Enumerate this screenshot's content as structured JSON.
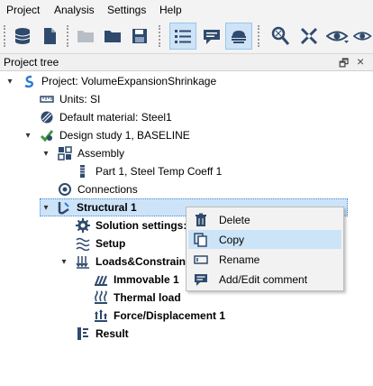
{
  "menu": [
    "Project",
    "Analysis",
    "Settings",
    "Help"
  ],
  "toolbar": {
    "buttons": [
      "database-icon",
      "new-document-icon",
      "open-folder-disabled-icon",
      "open-folder-icon",
      "save-icon",
      "list-view-icon",
      "comment-icon",
      "cloud-icon",
      "mesh-icon",
      "tools-icon",
      "eye-icon",
      "eye-icon"
    ]
  },
  "panel": {
    "title": "Project tree",
    "float_btn": "🗗",
    "close_btn": "×"
  },
  "tree": [
    {
      "label": "Project: VolumeExpansionShrinkage",
      "icon": "project-icon",
      "arrow": "▾",
      "bold": false
    },
    {
      "label": "Units: SI",
      "icon": "ruler-icon",
      "arrow": "",
      "bold": false
    },
    {
      "label": "Default material: Steel1",
      "icon": "material-icon",
      "arrow": "",
      "bold": false
    },
    {
      "label": "Design study 1, BASELINE",
      "icon": "design-study-icon",
      "arrow": "▾",
      "bold": false
    },
    {
      "label": "Assembly",
      "icon": "assembly-icon",
      "arrow": "▾",
      "bold": false
    },
    {
      "label": "Part 1, Steel Temp Coeff 1",
      "icon": "part-icon",
      "arrow": "",
      "bold": false
    },
    {
      "label": "Connections",
      "icon": "connections-icon",
      "arrow": "",
      "bold": false
    },
    {
      "label": "Structural  1",
      "icon": "structural-icon",
      "arrow": "▾",
      "bold": true,
      "selected": true
    },
    {
      "label": "Solution settings: A",
      "icon": "solution-settings-icon",
      "arrow": "",
      "bold": true
    },
    {
      "label": "Setup",
      "icon": "setup-icon",
      "arrow": "",
      "bold": true
    },
    {
      "label": "Loads&Constraints",
      "icon": "loads-icon",
      "arrow": "▾",
      "bold": true
    },
    {
      "label": "Immovable 1",
      "icon": "immovable-icon",
      "arrow": "",
      "bold": true
    },
    {
      "label": "Thermal load",
      "icon": "thermal-load-icon",
      "arrow": "",
      "bold": true
    },
    {
      "label": "Force/Displacement 1",
      "icon": "force-icon",
      "arrow": "",
      "bold": true
    },
    {
      "label": "Result",
      "icon": "result-icon",
      "arrow": "",
      "bold": true
    }
  ],
  "context_menu": [
    {
      "label": "Delete",
      "icon": "trash-icon"
    },
    {
      "label": "Copy",
      "icon": "copy-icon",
      "highlighted": true
    },
    {
      "label": "Rename",
      "icon": "rename-icon"
    },
    {
      "label": "Add/Edit comment",
      "icon": "comment-edit-icon"
    }
  ]
}
